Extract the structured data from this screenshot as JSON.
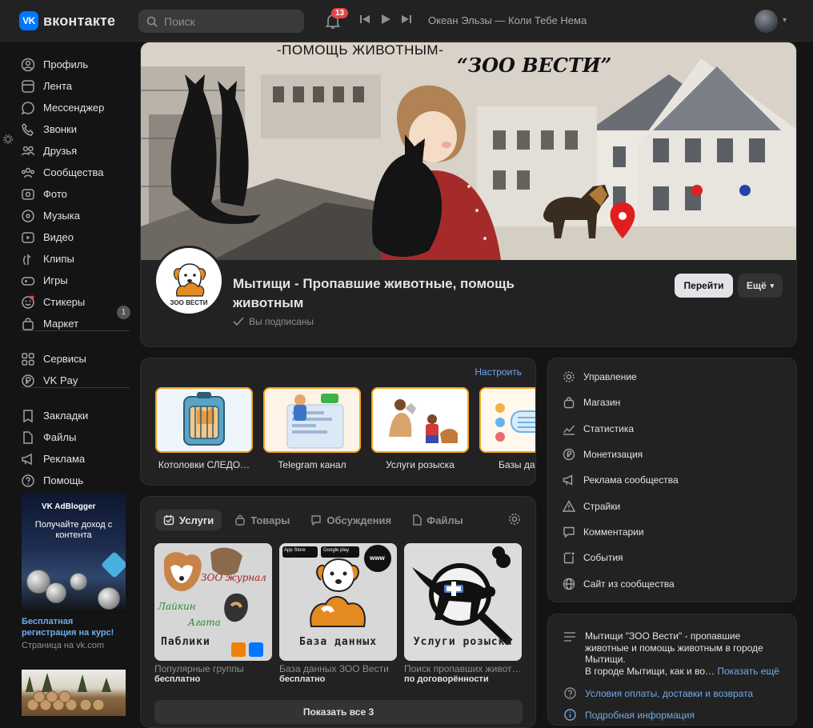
{
  "header": {
    "brand_badge": "VK",
    "brand": "вконтакте",
    "search_placeholder": "Поиск",
    "notifications_count": "13",
    "track": "Океан Эльзы — Коли Тебе Нема"
  },
  "sidebar": {
    "items": [
      {
        "label": "Профиль",
        "icon": "profile-icon"
      },
      {
        "label": "Лента",
        "icon": "feed-icon"
      },
      {
        "label": "Мессенджер",
        "icon": "messenger-icon"
      },
      {
        "label": "Звонки",
        "icon": "phone-icon"
      },
      {
        "label": "Друзья",
        "icon": "friends-icon"
      },
      {
        "label": "Сообщества",
        "icon": "communities-icon"
      },
      {
        "label": "Фото",
        "icon": "photo-icon"
      },
      {
        "label": "Музыка",
        "icon": "music-icon"
      },
      {
        "label": "Видео",
        "icon": "video-icon"
      },
      {
        "label": "Клипы",
        "icon": "clips-icon"
      },
      {
        "label": "Игры",
        "icon": "games-icon"
      },
      {
        "label": "Стикеры",
        "icon": "stickers-icon"
      },
      {
        "label": "Маркет",
        "icon": "market-icon"
      },
      {
        "label": "Сервисы",
        "icon": "services-icon"
      },
      {
        "label": "VK Pay",
        "icon": "vkpay-icon"
      },
      {
        "label": "Закладки",
        "icon": "bookmarks-icon"
      },
      {
        "label": "Файлы",
        "icon": "files-icon"
      },
      {
        "label": "Реклама",
        "icon": "ads-icon"
      },
      {
        "label": "Помощь",
        "icon": "help-icon"
      }
    ],
    "games_count": "1"
  },
  "ad": {
    "brand": "VK AdBlogger",
    "headline": "Получайте доход с контента",
    "link": "Бесплатная регистрация на курс!",
    "source": "Страница на vk.com"
  },
  "group": {
    "cover_title_1": "-ПОМОЩЬ ЖИВОТНЫМ-",
    "cover_title_2": "“ЗОО ВЕСТИ”",
    "avatar_text": "ЗОО ВЕСТИ",
    "name": "Мытищи - Пропавшие животные, помощь животным",
    "subscribed": "Вы подписаны",
    "go_button": "Перейти",
    "more_button": "Ещё"
  },
  "links": {
    "configure": "Настроить",
    "items": [
      "Котоловки СЛЕДО…",
      "Telegram канал",
      "Услуги розыска",
      "Базы дан"
    ]
  },
  "services": {
    "tabs": [
      {
        "label": "Услуги",
        "icon": "services-tab-icon"
      },
      {
        "label": "Товары",
        "icon": "goods-tab-icon"
      },
      {
        "label": "Обсуждения",
        "icon": "discussions-tab-icon"
      },
      {
        "label": "Файлы",
        "icon": "files-tab-icon"
      }
    ],
    "items": [
      {
        "name": "Популярные группы",
        "price": "бесплатно",
        "caption": "Паблики",
        "tile_texts": [
          "ЗОО журнал",
          "Лайкин",
          "Агата"
        ]
      },
      {
        "name": "База данных ЗОО Вести",
        "price": "бесплатно",
        "caption": "База данных",
        "tile_texts": [
          "App Store",
          "Google play",
          "www"
        ]
      },
      {
        "name": "Поиск пропавших живот…",
        "price": "по договорённости",
        "caption": "Услуги розыска",
        "tile_texts": []
      }
    ],
    "show_all": "Показать все 3"
  },
  "management": {
    "items": [
      {
        "label": "Управление",
        "icon": "gear-icon"
      },
      {
        "label": "Магазин",
        "icon": "shop-bag-icon"
      },
      {
        "label": "Статистика",
        "icon": "stats-icon"
      },
      {
        "label": "Монетизация",
        "icon": "ruble-icon"
      },
      {
        "label": "Реклама сообщества",
        "icon": "megaphone-icon"
      },
      {
        "label": "Страйки",
        "icon": "warning-icon"
      },
      {
        "label": "Комментарии",
        "icon": "comment-icon"
      },
      {
        "label": "События",
        "icon": "event-icon"
      },
      {
        "label": "Сайт из сообщества",
        "icon": "globe-icon"
      }
    ]
  },
  "about": {
    "text": "Мытищи \"ЗОО Вести\" - пропавшие животные и помощь животным в городе Мытищи.",
    "text2": "В городе Мытищи, как и во…",
    "more": "Показать ещё",
    "link1": "Условия оплаты, доставки и возврата",
    "link2": "Подробная информация"
  },
  "colors": {
    "accent": "#0077ff",
    "link": "#71aaeb",
    "badge": "#e64646",
    "tile_border": "#f5a623"
  }
}
